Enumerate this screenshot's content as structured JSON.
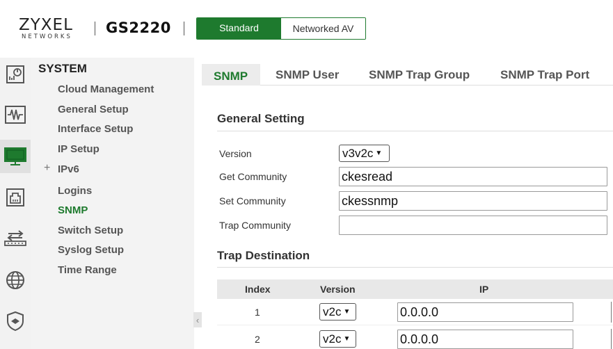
{
  "header": {
    "brand": "ZYXEL",
    "brand_sub": "NETWORKS",
    "model": "GS2220",
    "modes": [
      {
        "label": "Standard",
        "active": true
      },
      {
        "label": "Networked AV",
        "active": false
      }
    ],
    "accent_color": "#1e7a2e"
  },
  "rail": {
    "icons": [
      "dashboard-icon",
      "monitor-icon",
      "system-icon",
      "port-icon",
      "switching-icon",
      "network-icon",
      "security-icon"
    ],
    "active_index": 2
  },
  "menu": {
    "title": "SYSTEM",
    "items": [
      {
        "label": "Cloud Management"
      },
      {
        "label": "General Setup"
      },
      {
        "label": "Interface Setup"
      },
      {
        "label": "IP Setup"
      },
      {
        "label": "IPv6",
        "expandable": true
      },
      {
        "label": "Logins"
      },
      {
        "label": "SNMP",
        "active": true
      },
      {
        "label": "Switch Setup"
      },
      {
        "label": "Syslog Setup"
      },
      {
        "label": "Time Range"
      }
    ],
    "collapse_glyph": "‹"
  },
  "tabs": [
    {
      "label": "SNMP",
      "active": true
    },
    {
      "label": "SNMP User"
    },
    {
      "label": "SNMP Trap Group"
    },
    {
      "label": "SNMP Trap Port"
    }
  ],
  "general": {
    "title": "General Setting",
    "version_label": "Version",
    "version_value": "v3v2c",
    "get_label": "Get Community",
    "get_value": "ckesread",
    "set_label": "Set Community",
    "set_value": "ckessnmp",
    "trap_label": "Trap Community",
    "trap_value": ""
  },
  "trap": {
    "title": "Trap Destination",
    "columns": [
      "Index",
      "Version",
      "IP"
    ],
    "rows": [
      {
        "index": "1",
        "version": "v2c",
        "ip": "0.0.0.0"
      },
      {
        "index": "2",
        "version": "v2c",
        "ip": "0.0.0.0"
      }
    ]
  }
}
